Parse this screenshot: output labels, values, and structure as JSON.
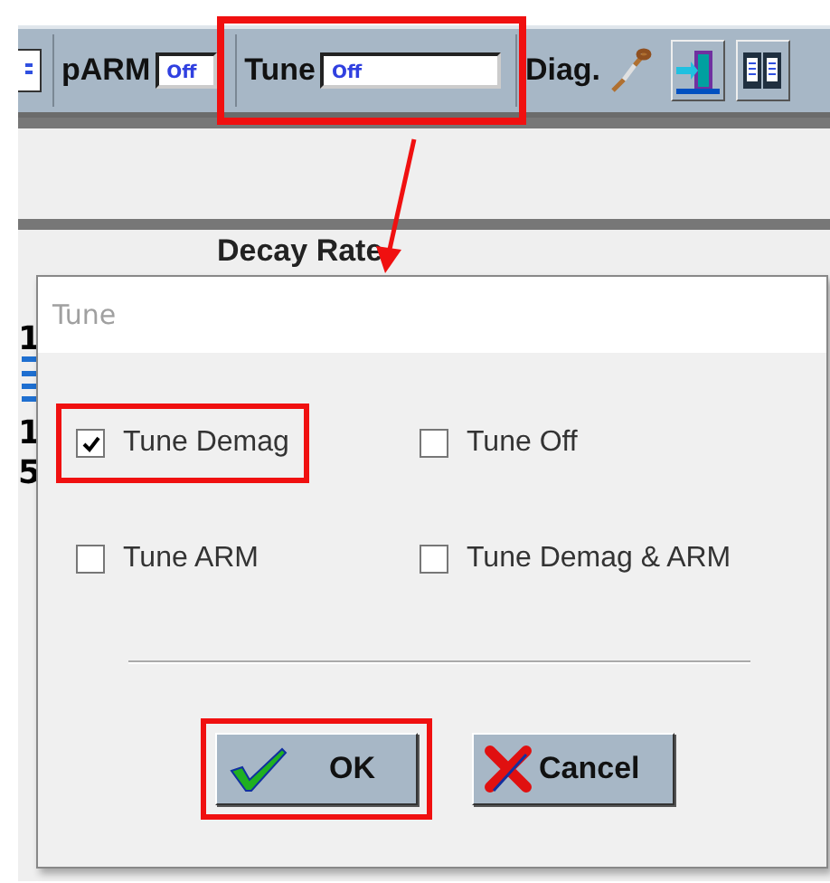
{
  "toolbar": {
    "items": [
      {
        "kind": "field",
        "label": "pARM",
        "value": "Off",
        "highlighted": false
      },
      {
        "kind": "field",
        "label": "Tune",
        "value": "Off",
        "highlighted": true
      },
      {
        "kind": "link",
        "label": "Diag.",
        "highlighted": false
      }
    ]
  },
  "background": {
    "heading": "Decay Rate",
    "column_1": [
      "1",
      "1",
      "5"
    ]
  },
  "dialog": {
    "title": "Tune",
    "options": [
      {
        "label": "Tune Demag",
        "checked": true,
        "highlighted": true
      },
      {
        "label": "Tune Off",
        "checked": false,
        "highlighted": false
      },
      {
        "label": "Tune ARM",
        "checked": false,
        "highlighted": false
      },
      {
        "label": "Tune Demag & ARM",
        "checked": false,
        "highlighted": false
      }
    ],
    "buttons": [
      {
        "kind": "ok",
        "label": "OK",
        "highlighted": true
      },
      {
        "kind": "cancel",
        "label": "Cancel",
        "highlighted": false
      }
    ]
  }
}
